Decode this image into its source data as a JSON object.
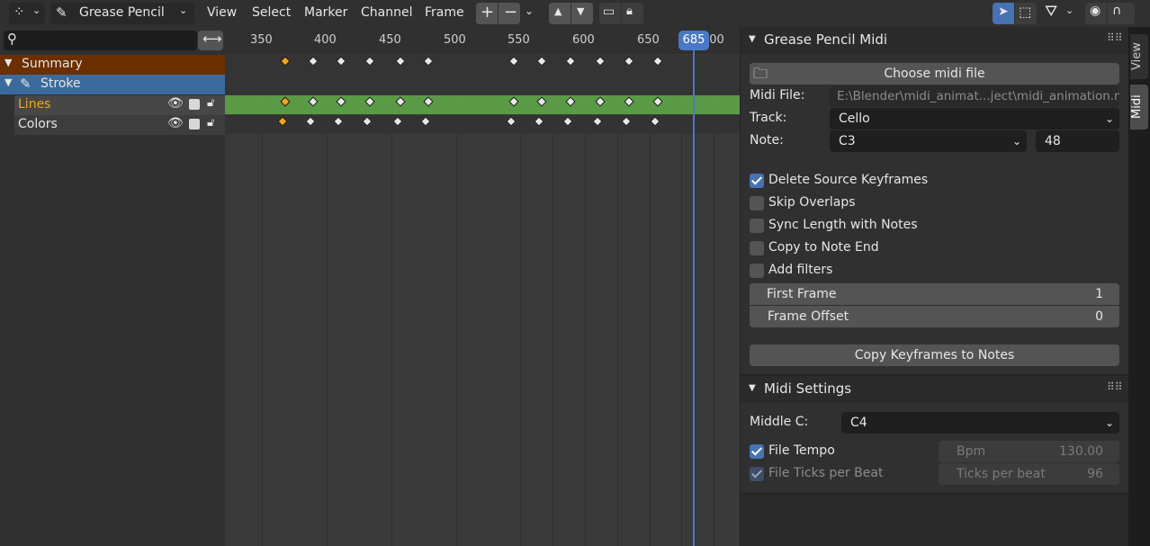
{
  "header": {
    "editor_mode": "Grease Pencil",
    "menus": [
      "View",
      "Select",
      "Marker",
      "Channel",
      "Frame"
    ]
  },
  "channels": {
    "search_placeholder": "",
    "summary": "Summary",
    "stroke": "Stroke",
    "lines": "Lines",
    "colors": "Colors"
  },
  "timeline": {
    "ticks": [
      "350",
      "400",
      "450",
      "500",
      "550",
      "600",
      "650",
      "700"
    ],
    "current_frame": "685"
  },
  "panel": {
    "title": "Grease Pencil Midi",
    "choose_button": "Choose midi file",
    "midi_file_label": "Midi File:",
    "midi_file_value": "E:\\Blender\\midi_animat...ject\\midi_animation.mid",
    "track_label": "Track:",
    "track_value": "Cello",
    "note_label": "Note:",
    "note_value": "C3",
    "note_number": "48",
    "checks": [
      {
        "label": "Delete Source Keyframes",
        "checked": true
      },
      {
        "label": "Skip Overlaps",
        "checked": false
      },
      {
        "label": "Sync Length with Notes",
        "checked": false
      },
      {
        "label": "Copy to Note End",
        "checked": false
      },
      {
        "label": "Add filters",
        "checked": false
      }
    ],
    "first_frame_label": "First Frame",
    "first_frame_value": "1",
    "frame_offset_label": "Frame Offset",
    "frame_offset_value": "0",
    "copy_button": "Copy Keyframes to Notes"
  },
  "settings": {
    "title": "Midi Settings",
    "middle_c_label": "Middle C:",
    "middle_c_value": "C4",
    "file_tempo_label": "File Tempo",
    "file_tempo_checked": true,
    "bpm_label": "Bpm",
    "bpm_value": "130.00",
    "ticks_label": "File Ticks per Beat",
    "ticks_checked": true,
    "ticks_field_label": "Ticks per beat",
    "ticks_field_value": "96"
  },
  "tabs": [
    "View",
    "Midi"
  ],
  "colors": {
    "summary_bg": "#6b2f00",
    "stroke_bg": "#3a6b9c",
    "lines_track": "#5a9a46",
    "playhead": "#4a78c6",
    "selected_key": "#f2a61f"
  }
}
